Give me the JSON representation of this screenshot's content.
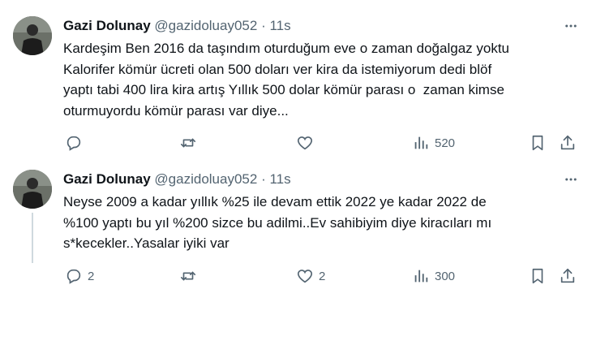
{
  "tweets": [
    {
      "author": "Gazi Dolunay",
      "handle": "@gazidoluay052",
      "dot": "·",
      "time": "11s",
      "text": "Kardeşim Ben 2016 da taşındım oturduğum eve o zaman doğalgaz yoktu\nKalorifer kömür ücreti olan 500 doları ver kira da istemiyorum dedi blöf\nyaptı tabi 400 lira kira artış Yıllık 500 dolar kömür parası o  zaman kimse\noturmuyordu kömür parası var diye...",
      "replies": "",
      "retweets": "",
      "likes": "",
      "views": "520"
    },
    {
      "author": "Gazi Dolunay",
      "handle": "@gazidoluay052",
      "dot": "·",
      "time": "11s",
      "text": "Neyse 2009 a kadar yıllık %25 ile devam ettik 2022 ye kadar 2022 de\n%100 yaptı bu yıl %200 sizce bu adilmi..Ev sahibiyim diye kiracıları mı\ns*kecekler..Yasalar iyiki var",
      "replies": "2",
      "retweets": "",
      "likes": "2",
      "views": "300"
    }
  ],
  "icons": {
    "reply": "speech-bubble-icon",
    "retweet": "retweet-icon",
    "like": "heart-icon",
    "views": "bar-chart-icon",
    "bookmark": "bookmark-icon",
    "share": "share-icon",
    "more": "more-dots-icon"
  },
  "colors": {
    "text": "#0f1419",
    "secondary": "#536471",
    "thread": "#cfd9de"
  }
}
